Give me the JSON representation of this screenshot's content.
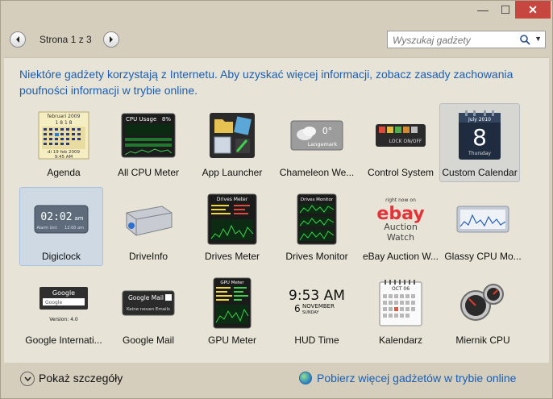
{
  "window": {
    "minimize_glyph": "—",
    "maximize_glyph": "☐",
    "close_glyph": "✕"
  },
  "nav": {
    "page_label": "Strona 1 z 3",
    "prev_icon": "chevron-left-icon",
    "next_icon": "chevron-right-icon"
  },
  "search": {
    "placeholder": "Wyszukaj gadżety"
  },
  "info_text": "Niektóre gadżety korzystają z Internetu. Aby uzyskać więcej informacji, zobacz zasady zachowania poufności informacji w trybie online.",
  "gadgets": [
    {
      "label": "Agenda",
      "art": {
        "month": "februari 2009",
        "days": "1 8 1 8",
        "footer": "di 19 feb 2009",
        "time": "9:45 AM"
      }
    },
    {
      "label": "All CPU Meter",
      "art": {
        "title": "CPU Usage",
        "pct": "8%"
      }
    },
    {
      "label": "App Launcher"
    },
    {
      "label": "Chameleon We...",
      "art": {
        "temp": "0°",
        "place": "Langemark"
      }
    },
    {
      "label": "Control System",
      "art": {
        "text": "LOCK ON/OFF"
      }
    },
    {
      "label": "Custom Calendar",
      "art": {
        "month": "July 2010",
        "day": "8",
        "weekday": "Thursday"
      }
    },
    {
      "label": "Digiclock",
      "art": {
        "time": "02:02",
        "ampm": "am",
        "sub1": "Alarm Unt",
        "sub2": "12:00 am"
      }
    },
    {
      "label": "DriveInfo"
    },
    {
      "label": "Drives Meter",
      "art": {
        "title": "Drives Meter"
      }
    },
    {
      "label": "Drives Monitor",
      "art": {
        "title": "Drives Monitor"
      }
    },
    {
      "label": "eBay Auction W...",
      "art": {
        "top": "right now on",
        "brand": "ebay",
        "line1": "Auction",
        "line2": "Watch"
      }
    },
    {
      "label": "Glassy CPU Mo..."
    },
    {
      "label": "Google Internati...",
      "art": {
        "brand": "Google",
        "field": "Google",
        "version": "Version: 4.0"
      }
    },
    {
      "label": "Google Mail",
      "art": {
        "brand": "Google Mail",
        "sub": "Keine neuen Emails"
      }
    },
    {
      "label": "GPU Meter",
      "art": {
        "title": "GPU Meter"
      }
    },
    {
      "label": "HUD Time",
      "art": {
        "time": "9:53 AM",
        "day": "6",
        "month": "NOVEMBER",
        "weekday": "SUNDAY"
      }
    },
    {
      "label": "Kalendarz",
      "art": {
        "header": "OCT 06"
      }
    },
    {
      "label": "Miernik CPU"
    }
  ],
  "footer": {
    "details_label": "Pokaż szczegóły",
    "online_link": "Pobierz więcej gadżetów w trybie online"
  }
}
